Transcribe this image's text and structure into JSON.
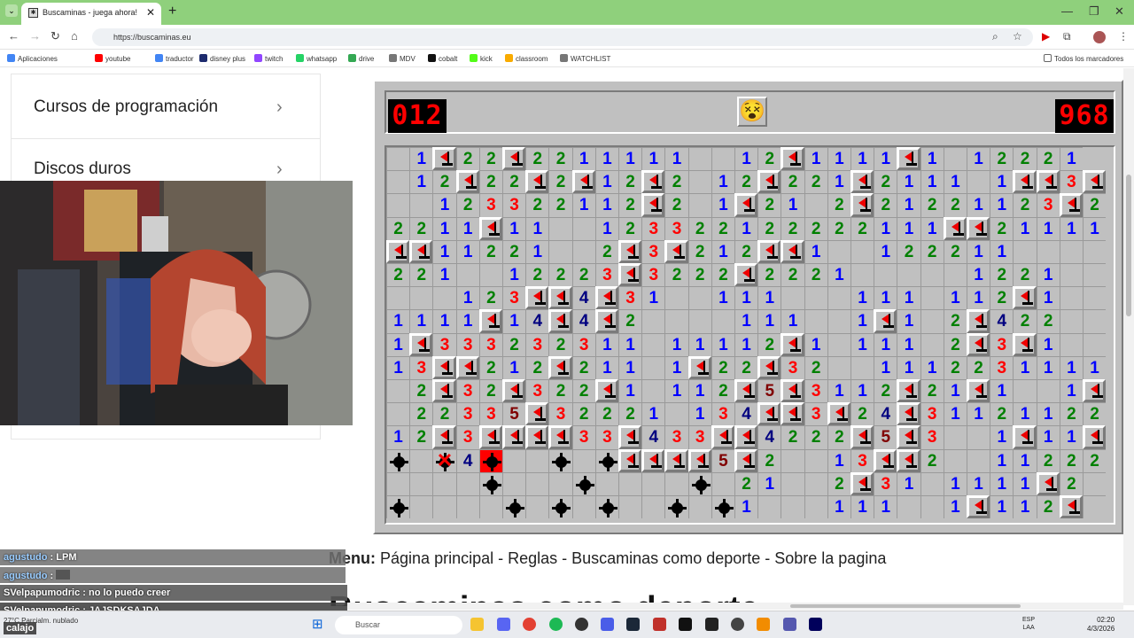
{
  "browser": {
    "tab_title": "Buscaminas - juega ahora!",
    "url": "https://buscaminas.eu",
    "tab_close": "✕",
    "new_tab": "+"
  },
  "bookmarks": [
    {
      "label": "Aplicaciones",
      "color": "#4285f4"
    },
    {
      "label": "youtube",
      "color": "#ff0000"
    },
    {
      "label": "traductor",
      "color": "#4285f4"
    },
    {
      "label": "disney plus",
      "color": "#1d2b6e"
    },
    {
      "label": "twitch",
      "color": "#9146ff"
    },
    {
      "label": "whatsapp",
      "color": "#25d366"
    },
    {
      "label": "drive",
      "color": "#34a853"
    },
    {
      "label": "MDV",
      "color": "#777777"
    },
    {
      "label": "cobalt",
      "color": "#111111"
    },
    {
      "label": "kick",
      "color": "#53fc18"
    },
    {
      "label": "classroom",
      "color": "#f9ab00"
    },
    {
      "label": "WATCHLIST",
      "color": "#777777"
    }
  ],
  "bookmarks_all": "Todos los marcadores",
  "sidebar": {
    "items": [
      {
        "label": "Cursos de programación"
      },
      {
        "label": "Discos duros"
      }
    ]
  },
  "game": {
    "mine_counter": "012",
    "timer": "968",
    "face": "😵",
    "status": "lost"
  },
  "board": [
    ". 1 F 2 2 F 2 2 1 1 1 1 1 . . 1 2 F 1 1 1 1 F 1 . 1 2 2 2 1",
    ". 1 2 F 2 2 F 2 F 1 2 F 2 . 1 2 F 2 2 1 F 2 1 1 1 . 1 F F 3 F",
    ". . 1 2 3 3 2 2 1 1 2 F 2 . 1 F 2 1 . 2 F 2 1 2 2 1 1 2 3 F 2",
    "2 2 1 1 F 1 1 . . 1 2 3 3 2 2 1 2 2 2 2 2 1 1 1 F F 2 1 1 1 1 1",
    "F F 1 1 2 2 1 . . 2 F 3 F 2 1 2 F F 1 . . 1 2 2 2 1 1 . . . .",
    "2 2 1 . . 1 2 2 2 3 F 3 2 2 2 F 2 2 2 1 . . . . . 1 2 2 1 . .",
    ". . . 1 2 3 F F 4 F 3 1 . . 1 1 1 . . . 1 1 1 . 1 1 2 F 1 . .",
    "1 1 1 1 F 1 4 F 4 F 2 . . . . 1 1 1 . . 1 F 1 . 2 F 4 2 2 . .",
    "1 F 3 3 3 2 3 2 3 1 1 . 1 1 1 1 2 F 1 . 1 1 1 . 2 F 3 F 1 . .",
    "1 3 F F 2 1 2 F 2 1 1 . 1 F 2 2 F 3 2 . . 1 1 1 2 2 3 1 1 1 1",
    ". 2 F 3 2 F 3 2 2 F 1 . 1 1 2 F 5 F 3 1 1 2 F 2 1 F 1 . . 1 F",
    ". 2 2 3 3 5 F 3 2 2 2 1 . 1 3 4 F F 3 F 2 4 F 3 1 1 2 1 1 2 2",
    "1 2 F 3 F F F F 3 3 F 4 3 3 F F 4 2 2 2 F 5 F 3 . . 1 F 1 1 F",
    "M . X 4 B . . M . M F F F F 5 F 2 . . 1 3 F F 2 . . 1 1 2 2 2",
    ". . . . M . . . M . . . . M . 2 1 . . 2 F 3 1 . 1 1 1 1 F 2 .",
    "M . . . . M . M . M . . M . M 1 . . . 1 1 1 . . 1 F 1 1 2 F ."
  ],
  "menu": {
    "label": "Menu:",
    "links": [
      "Página principal",
      "Reglas",
      "Buscaminas como deporte",
      "Sobre la pagina"
    ],
    "sep": " - "
  },
  "big_heading_partial": "Buscaminas como deporte",
  "chat": [
    {
      "user": "agustudo",
      "msg": "LPM"
    },
    {
      "user": "agustudo",
      "msg": ""
    },
    {
      "user": "SVelpapumodric",
      "msg": "no lo puedo creer"
    },
    {
      "user": "SVelpapumodric",
      "msg": "JAJSDKSAJDA"
    }
  ],
  "chat_overlay": "calajo",
  "taskbar": {
    "search_placeholder": "Buscar",
    "weather_temp": "27°C",
    "weather_desc": "Parcialm. nublado",
    "time": "02:20",
    "date": "4/3/2026",
    "lang1": "ESP",
    "lang2": "LAA"
  }
}
